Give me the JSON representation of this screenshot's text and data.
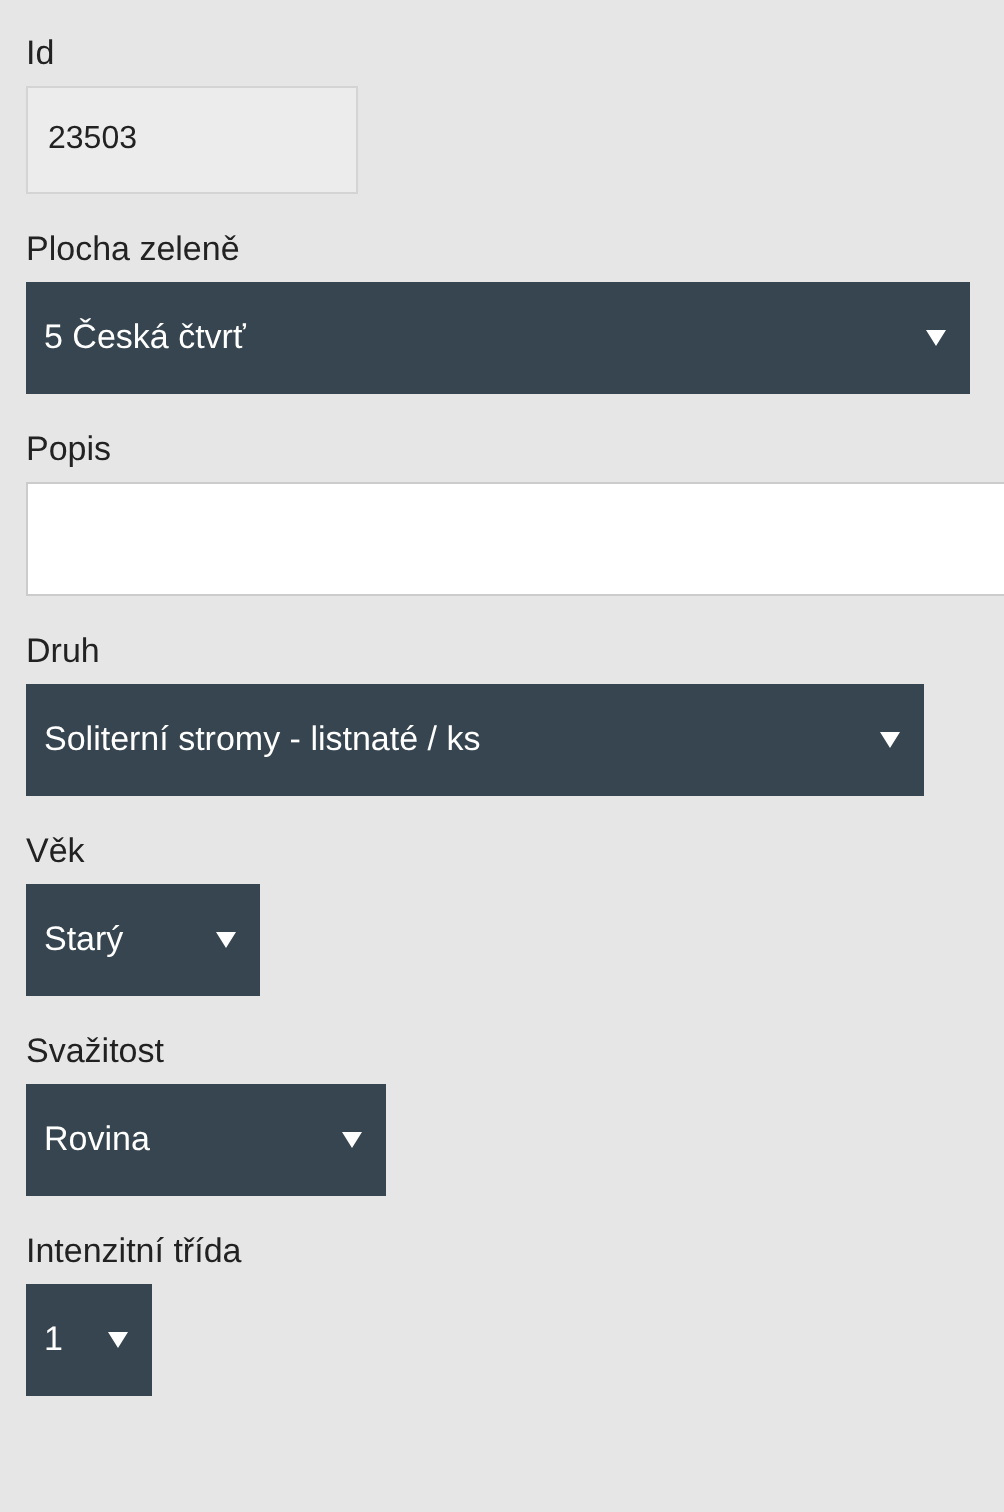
{
  "fields": [
    {
      "kind": "readonly",
      "label": "Id",
      "value": "23503"
    },
    {
      "kind": "select",
      "label": "Plocha zeleně",
      "value": "5 Česká čtvrť"
    },
    {
      "kind": "input",
      "label": "Popis"
    },
    {
      "kind": "select",
      "label": "Druh",
      "value": "Soliterní stromy - listnaté / ks"
    },
    {
      "kind": "select",
      "label": "Věk",
      "value": "Starý"
    },
    {
      "kind": "select",
      "label": "Svažitost",
      "value": "Rovina"
    },
    {
      "kind": "select",
      "label": "Intenzitní třída",
      "value": "1"
    }
  ]
}
